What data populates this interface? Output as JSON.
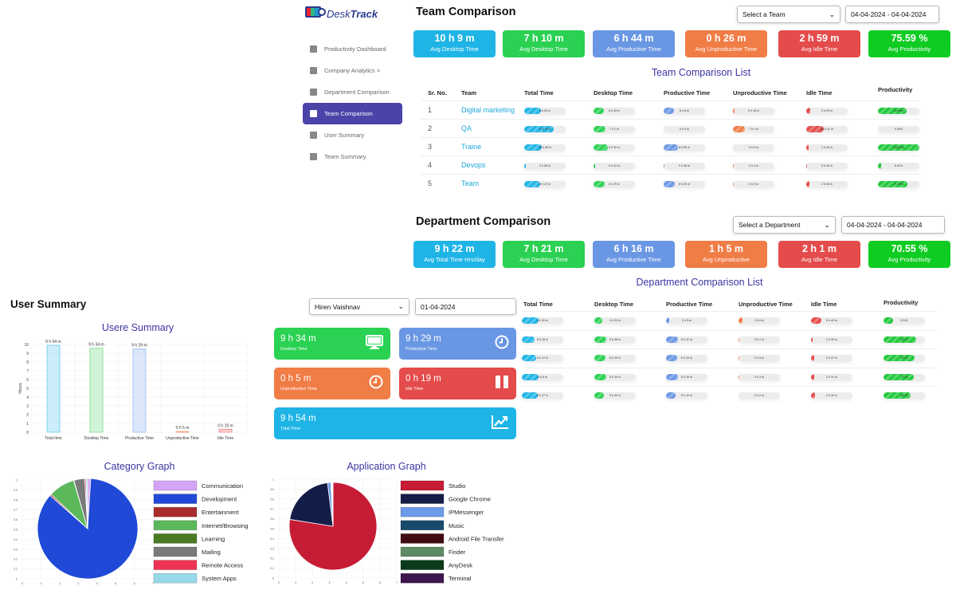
{
  "app": {
    "logo_prefix": "Desk",
    "logo_suffix": "Track"
  },
  "sidebar": {
    "items": [
      {
        "label": "Productivity Dashboard",
        "icon": "grid-icon",
        "active": false
      },
      {
        "label": "Company Analytics  >",
        "icon": "factory-icon",
        "active": false
      },
      {
        "label": "Department Comparison",
        "icon": "snowflake-icon",
        "active": false
      },
      {
        "label": "Team Comparison",
        "icon": "users-icon",
        "active": true
      },
      {
        "label": "User Summary",
        "icon": "document-icon",
        "active": false
      },
      {
        "label": "Team Summary",
        "icon": "users-icon",
        "active": false
      }
    ]
  },
  "team_comparison": {
    "title": "Team Comparison",
    "select": "Select a Team",
    "date_range": "04-04-2024 - 04-04-2024",
    "stats": [
      {
        "value": "10 h 9 m",
        "label": "Avg Desktop Time",
        "color": "#1eb4e6"
      },
      {
        "value": "7 h 10 m",
        "label": "Avg Desktop Time",
        "color": "#2ad152"
      },
      {
        "value": "6 h 44 m",
        "label": "Avg Productive Time",
        "color": "#6a97e4"
      },
      {
        "value": "0 h 26 m",
        "label": "Avg Unproductive Time",
        "color": "#f07c46"
      },
      {
        "value": "2 h 59 m",
        "label": "Avg Idle Time",
        "color": "#e44b4b"
      },
      {
        "value": "75.59 %",
        "label": "Avg Productivity",
        "color": "#0fcc22"
      }
    ],
    "list_title": "Team Comparison List",
    "columns": [
      "Sr. No.",
      "Team",
      "Total Time",
      "Desktop Time",
      "Productive Time",
      "Unproductive Time",
      "Idle Time",
      "Productivity"
    ],
    "rows": [
      {
        "sr": "1",
        "team": "Digital marketing",
        "total": {
          "text": "9 h 54 m",
          "pct": 40
        },
        "desktop": {
          "text": "6 h 34 m",
          "pct": 25
        },
        "productive": {
          "text": "6 h 6 m",
          "pct": 25
        },
        "unproductive": {
          "text": "0 h 18 m",
          "pct": 3
        },
        "idle": {
          "text": "3 h 29 m",
          "pct": 10
        },
        "productivity": {
          "text": "69.46%",
          "pct": 69
        }
      },
      {
        "sr": "2",
        "team": "QA",
        "total": {
          "text": "17 h 49 m",
          "pct": 72
        },
        "desktop": {
          "text": "7 h 2 m",
          "pct": 28
        },
        "productive": {
          "text": "0 h 0 m",
          "pct": 0
        },
        "unproductive": {
          "text": "7 h 2 m",
          "pct": 28
        },
        "idle": {
          "text": "10 h 41 m",
          "pct": 43
        },
        "productivity": {
          "text": "0.00%",
          "pct": 0
        }
      },
      {
        "sr": "3",
        "team": "Traine",
        "total": {
          "text": "10 h 36 m",
          "pct": 42
        },
        "desktop": {
          "text": "8 h 50 m",
          "pct": 35
        },
        "productive": {
          "text": "8 h 50 m",
          "pct": 35
        },
        "unproductive": {
          "text": "0 h 0 m",
          "pct": 0
        },
        "idle": {
          "text": "1 h 39 m",
          "pct": 5
        },
        "productivity": {
          "text": "100.29%",
          "pct": 100
        }
      },
      {
        "sr": "4",
        "team": "Devops",
        "total": {
          "text": "0 h 58 m",
          "pct": 4
        },
        "desktop": {
          "text": "0 h 41 m",
          "pct": 3
        },
        "productive": {
          "text": "0 h 36 m",
          "pct": 2
        },
        "unproductive": {
          "text": "0 h 4 m",
          "pct": 1
        },
        "idle": {
          "text": "0 h 16 m",
          "pct": 1
        },
        "productivity": {
          "text": "6.91%",
          "pct": 7
        }
      },
      {
        "sr": "5",
        "team": "Team",
        "total": {
          "text": "9 h 22 m",
          "pct": 38
        },
        "desktop": {
          "text": "6 h 29 m",
          "pct": 26
        },
        "productive": {
          "text": "6 h 26 m",
          "pct": 26
        },
        "unproductive": {
          "text": "0 h 2 m",
          "pct": 1
        },
        "idle": {
          "text": "2 h 53 m",
          "pct": 8
        },
        "productivity": {
          "text": "71.25%",
          "pct": 71
        }
      }
    ]
  },
  "department_comparison": {
    "title": "Department Comparison",
    "select": "Select a Department",
    "date_range": "04-04-2024 - 04-04-2024",
    "stats": [
      {
        "value": "9 h 22 m",
        "label": "Avg Total Time Hrs/day",
        "color": "#1eb4e6"
      },
      {
        "value": "7 h 21 m",
        "label": "Avg Desktop Time",
        "color": "#2ad152"
      },
      {
        "value": "6 h 16 m",
        "label": "Avg Productive Time",
        "color": "#6a97e4"
      },
      {
        "value": "1 h 5 m",
        "label": "Avg Unproductive",
        "color": "#f07c46"
      },
      {
        "value": "2 h 1 m",
        "label": "Avg Idle Time",
        "color": "#e44b4b"
      },
      {
        "value": "70.55 %",
        "label": "Avg Productivity",
        "color": "#0fcc22"
      }
    ],
    "list_title": "Department Comparison List",
    "columns": [
      "Total Time",
      "Desktop Time",
      "Productive Time",
      "Unproductive Time",
      "Idle Time",
      "Productivity"
    ],
    "rows": [
      {
        "total": {
          "text": "8 h 50 m",
          "pct": 40
        },
        "desktop": {
          "text": "4 h 53 m",
          "pct": 20
        },
        "productive": {
          "text": "2 h 5 m",
          "pct": 8
        },
        "unproductive": {
          "text": "2 h 8 m",
          "pct": 10
        },
        "idle": {
          "text": "5 h 43 m",
          "pct": 25
        },
        "productivity": {
          "text": "22.62",
          "pct": 23
        }
      },
      {
        "total": {
          "text": "8 h 18 m",
          "pct": 30
        },
        "desktop": {
          "text": "6 h 48 m",
          "pct": 28
        },
        "productive": {
          "text": "6 h 47 m",
          "pct": 28
        },
        "unproductive": {
          "text": "0 h 1 m",
          "pct": 1
        },
        "idle": {
          "text": "1 h 29 m",
          "pct": 4
        },
        "productivity": {
          "text": "78.71",
          "pct": 79
        }
      },
      {
        "total": {
          "text": "8 h 12 m",
          "pct": 35
        },
        "desktop": {
          "text": "6 h 25 m",
          "pct": 27
        },
        "productive": {
          "text": "6 h 23 m",
          "pct": 27
        },
        "unproductive": {
          "text": "0 h 9 m",
          "pct": 2
        },
        "idle": {
          "text": "2 h 47 m",
          "pct": 8
        },
        "productivity": {
          "text": "75.32",
          "pct": 75
        }
      },
      {
        "total": {
          "text": "9 h 6 m",
          "pct": 40
        },
        "desktop": {
          "text": "6 h 34 m",
          "pct": 28
        },
        "productive": {
          "text": "6 h 33 m",
          "pct": 28
        },
        "unproductive": {
          "text": "0 h 3 m",
          "pct": 1
        },
        "idle": {
          "text": "2 h 31 m",
          "pct": 8
        },
        "productivity": {
          "text": "73.36",
          "pct": 73
        }
      },
      {
        "total": {
          "text": "8 h 17 m",
          "pct": 38
        },
        "desktop": {
          "text": "5 h 42 m",
          "pct": 24
        },
        "productive": {
          "text": "5 h 42 m",
          "pct": 24
        },
        "unproductive": {
          "text": "0 h 0 m",
          "pct": 0
        },
        "idle": {
          "text": "3 h 34 m",
          "pct": 10
        },
        "productivity": {
          "text": "66.03",
          "pct": 66
        }
      }
    ]
  },
  "user_summary": {
    "title": "User Summary",
    "user_select": "Hiren Vaishnav",
    "date": "01-04-2024",
    "cards": [
      {
        "value": "9 h 34 m",
        "label": "Desktop Time",
        "icon": "monitor-icon",
        "color": "#2ad152"
      },
      {
        "value": "9 h 29 m",
        "label": "Productive Time",
        "icon": "clock-icon",
        "color": "#6a97e4"
      },
      {
        "value": "0 h 5 m",
        "label": "Unproductive Time",
        "icon": "clock-icon",
        "color": "#f07c46"
      },
      {
        "value": "0 h 19 m",
        "label": "Idle Time",
        "icon": "pause-icon",
        "color": "#e44b4b"
      },
      {
        "value": "9 h 54 m",
        "label": "Total Time",
        "icon": "trend-chart-icon",
        "color": "#1eb4e6"
      }
    ]
  },
  "chart_data": [
    {
      "type": "bar",
      "title": "Usere Summary",
      "xlabel": "",
      "ylabel": "Hours",
      "ylim": [
        0,
        10
      ],
      "yticks": [
        0,
        1,
        2,
        3,
        4,
        5,
        6,
        7,
        8,
        9,
        10
      ],
      "grid": true,
      "categories": [
        "Total time",
        "Desktop Time",
        "Productive Time",
        "Unproductive Time",
        "Idle Time"
      ],
      "values": [
        9.9,
        9.57,
        9.48,
        0.08,
        0.32
      ],
      "data_labels": [
        "9 h 54 m",
        "9 h 34 m",
        "9 h 29 m",
        "0 h 5 m",
        "0 h 19 m"
      ],
      "colors": [
        "#7fd3ef",
        "#8be29d",
        "#a8c3f3",
        "#f5a98a",
        "#f29191"
      ]
    },
    {
      "type": "pie",
      "title": "Category Graph",
      "legend": "right",
      "x_ticks": [
        0,
        1,
        2,
        3,
        4,
        5,
        6,
        7
      ],
      "y_ticks": [
        0,
        0.1,
        0.2,
        0.3,
        0.4,
        0.5,
        0.6,
        0.7,
        0.8,
        0.9,
        1
      ],
      "slices": [
        {
          "label": "Communication",
          "value": 1.0,
          "color": "#d4a5f7"
        },
        {
          "label": "Development",
          "value": 85.5,
          "color": "#1f49d6"
        },
        {
          "label": "Entertainment",
          "value": 0.5,
          "color": "#a92b2b"
        },
        {
          "label": "Internet/Browsing",
          "value": 8.5,
          "color": "#5bb85b"
        },
        {
          "label": "Learning",
          "value": 0.1,
          "color": "#4a7a24"
        },
        {
          "label": "Mailing",
          "value": 3.5,
          "color": "#7a7a7a"
        },
        {
          "label": "Remote Access",
          "value": 0.4,
          "color": "#ee3355"
        },
        {
          "label": "System Apps",
          "value": 0.5,
          "color": "#97d8ea"
        }
      ]
    },
    {
      "type": "pie",
      "title": "Application Graph",
      "legend": "right",
      "x_ticks": [
        0,
        1,
        2,
        3,
        4,
        5,
        6,
        7
      ],
      "y_ticks": [
        0,
        0.1,
        0.2,
        0.3,
        0.4,
        0.5,
        0.6,
        0.7,
        0.8,
        0.9,
        1
      ],
      "slices": [
        {
          "label": "Studio",
          "value": 77.5,
          "color": "#c71c36"
        },
        {
          "label": "Google Chrome",
          "value": 20.5,
          "color": "#141c48"
        },
        {
          "label": "IPMessenger",
          "value": 1.2,
          "color": "#6b9ae8"
        },
        {
          "label": "Music",
          "value": 0.2,
          "color": "#184a6e"
        },
        {
          "label": "Android File Transfer",
          "value": 0.1,
          "color": "#3f0c12"
        },
        {
          "label": "Finder",
          "value": 0.2,
          "color": "#5e8a64"
        },
        {
          "label": "AnyDesk",
          "value": 0.1,
          "color": "#0a3a1a"
        },
        {
          "label": "Terminal",
          "value": 0.2,
          "color": "#3e164e"
        }
      ]
    }
  ]
}
